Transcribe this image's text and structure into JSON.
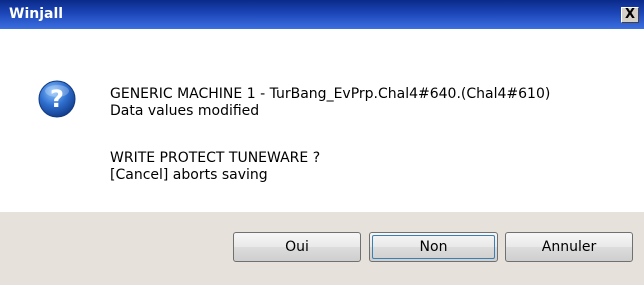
{
  "window": {
    "title": "Winjall",
    "close_glyph": "X"
  },
  "message": {
    "icon": "question-icon",
    "lines": [
      "GENERIC MACHINE 1 - TurBang_EvPrp.Chal4#640.(Chal4#610)",
      "Data values modified",
      "WRITE PROTECT TUNEWARE ?",
      "[Cancel] aborts saving"
    ]
  },
  "buttons": {
    "yes_label": "Oui",
    "no_label": "Non",
    "cancel_label": "Annuler",
    "default": "Non"
  },
  "colors": {
    "titlebar": "#1c46b8",
    "footer": "#e6e1db",
    "icon": "#2f6fcf"
  }
}
